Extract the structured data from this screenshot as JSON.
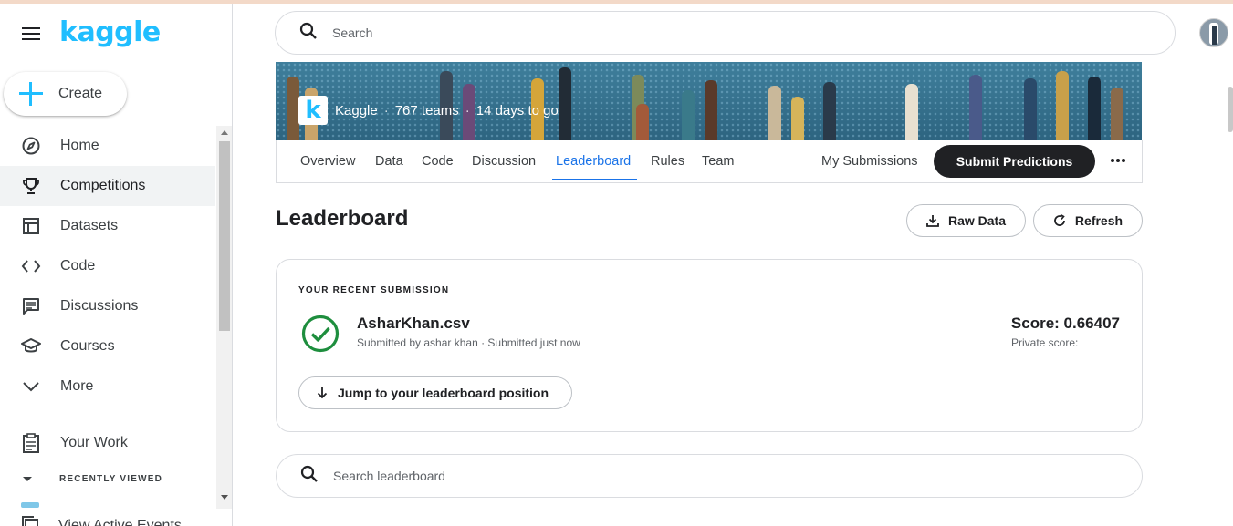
{
  "app": {
    "logo_text": "kaggle",
    "brand_color": "#20beff"
  },
  "sidebar": {
    "create_label": "Create",
    "items": [
      {
        "label": "Home",
        "icon": "compass-icon"
      },
      {
        "label": "Competitions",
        "icon": "trophy-icon",
        "active": true
      },
      {
        "label": "Datasets",
        "icon": "table-icon"
      },
      {
        "label": "Code",
        "icon": "code-icon"
      },
      {
        "label": "Discussions",
        "icon": "comments-icon"
      },
      {
        "label": "Courses",
        "icon": "school-icon"
      },
      {
        "label": "More",
        "icon": "chevron-down-icon"
      }
    ],
    "your_work": "Your Work",
    "recently_viewed": "RECENTLY VIEWED",
    "view_active_events": "View Active Events"
  },
  "search": {
    "placeholder": "Search"
  },
  "competition": {
    "host": "Kaggle",
    "teams": "767 teams",
    "deadline": "14 days to go",
    "logo_letter": "k"
  },
  "tabs": [
    {
      "label": "Overview"
    },
    {
      "label": "Data"
    },
    {
      "label": "Code"
    },
    {
      "label": "Discussion"
    },
    {
      "label": "Leaderboard",
      "active": true
    },
    {
      "label": "Rules"
    },
    {
      "label": "Team"
    }
  ],
  "actions": {
    "my_submissions": "My Submissions",
    "submit": "Submit Predictions"
  },
  "leaderboard": {
    "title": "Leaderboard",
    "raw_data": "Raw Data",
    "refresh": "Refresh",
    "search_placeholder": "Search leaderboard"
  },
  "recent_submission": {
    "caption": "YOUR RECENT SUBMISSION",
    "file_name": "AsharKhan.csv",
    "submitted_by": "Submitted by ashar khan · Submitted just now",
    "score": "Score: 0.66407",
    "private_score": "Private score:",
    "jump_label": "Jump to your leaderboard position",
    "status_color": "#1e8e3e"
  }
}
